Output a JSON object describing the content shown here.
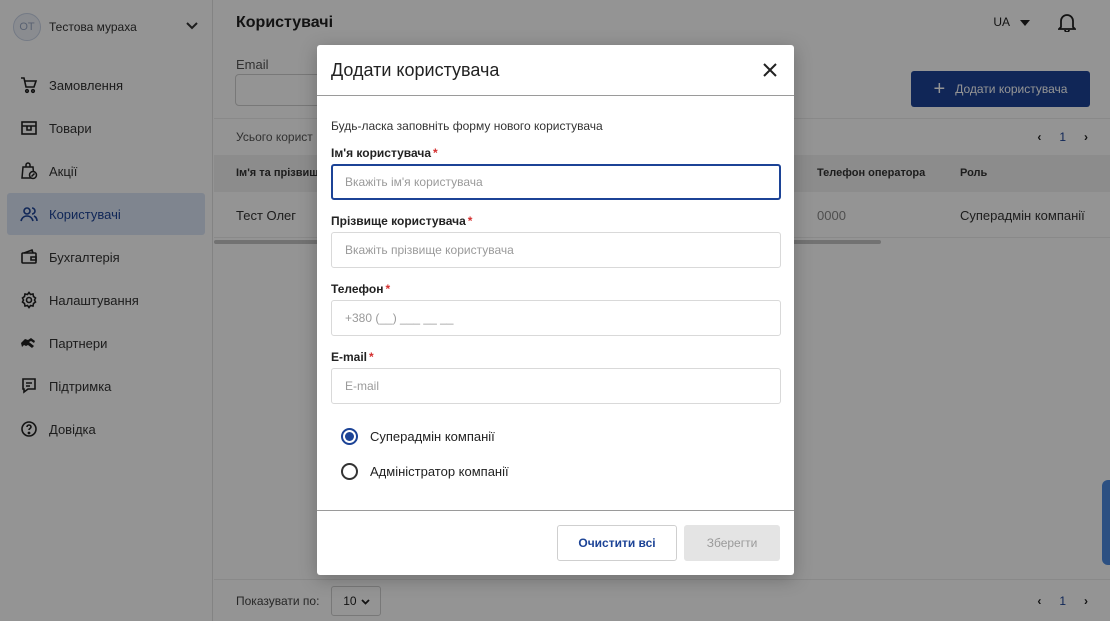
{
  "sidebar": {
    "company": {
      "initials": "OT",
      "name": "Тестова мураха"
    },
    "items": [
      {
        "label": "Замовлення",
        "icon": "cart-icon"
      },
      {
        "label": "Товари",
        "icon": "box-icon"
      },
      {
        "label": "Акції",
        "icon": "promo-bag-icon"
      },
      {
        "label": "Користувачі",
        "icon": "users-icon",
        "active": true
      },
      {
        "label": "Бухгалтерія",
        "icon": "wallet-icon"
      },
      {
        "label": "Налаштування",
        "icon": "gear-icon"
      },
      {
        "label": "Партнери",
        "icon": "handshake-icon"
      },
      {
        "label": "Підтримка",
        "icon": "chat-icon"
      },
      {
        "label": "Довідка",
        "icon": "help-icon"
      }
    ]
  },
  "header": {
    "title": "Користувачі",
    "language": "UA"
  },
  "filters": {
    "email_label": "Email"
  },
  "actions": {
    "add_user_label": "Додати користувача"
  },
  "table": {
    "total_label": "Усього корист",
    "page": "1",
    "columns": [
      "Ім'я та прізвищ",
      "Телефон оператора",
      "Роль"
    ],
    "rows": [
      {
        "name": "Тест Олег",
        "operator_phone": "0000",
        "role": "Суперадмін компанії"
      }
    ]
  },
  "footer": {
    "show_label": "Показувати по:",
    "page_size": "10",
    "page": "1"
  },
  "modal": {
    "title": "Додати користувача",
    "intro": "Будь-ласка заповніть форму нового користувача",
    "fields": {
      "first_name": {
        "label": "Ім'я користувача",
        "placeholder": "Вкажіть ім'я користувача"
      },
      "last_name": {
        "label": "Прізвище користувача",
        "placeholder": "Вкажіть прізвище користувача"
      },
      "phone": {
        "label": "Телефон",
        "placeholder": "+380 (__) ___ __ __"
      },
      "email": {
        "label": "E-mail",
        "placeholder": "E-mail"
      }
    },
    "roles": [
      {
        "label": "Суперадмін компанії",
        "selected": true
      },
      {
        "label": "Адміністратор компанії",
        "selected": false
      }
    ],
    "clear_label": "Очистити всі",
    "save_label": "Зберегти"
  },
  "colors": {
    "primary": "#1c4396",
    "active_bg": "#dbe6f7",
    "required": "#d32f2f"
  }
}
